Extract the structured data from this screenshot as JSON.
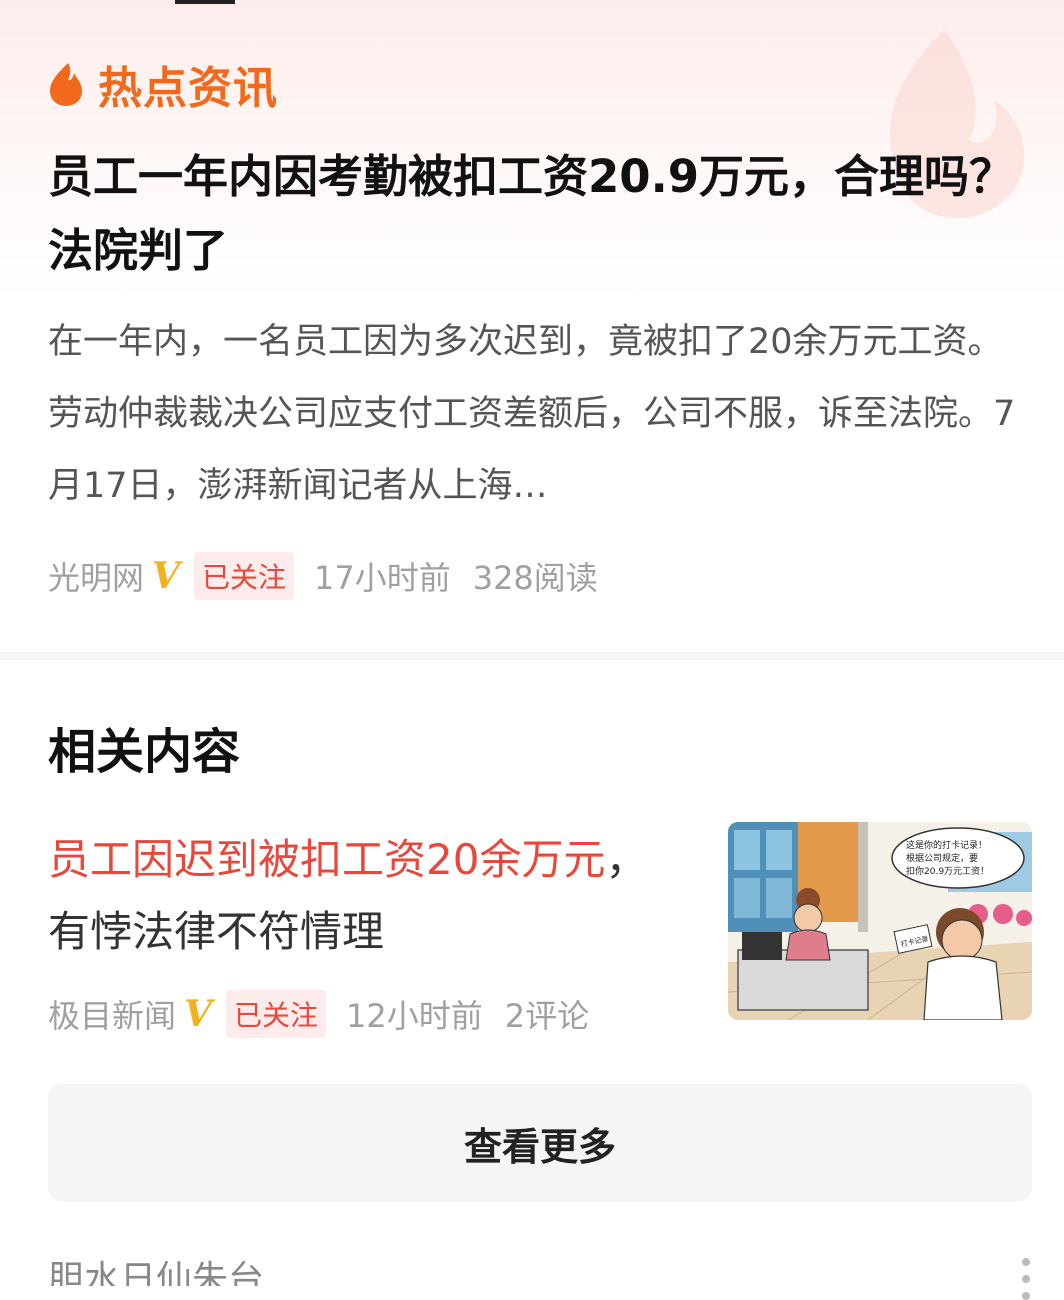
{
  "hot_section": {
    "label": "热点资讯",
    "headline": "员工一年内因考勤被扣工资20.9万元，合理吗？法院判了",
    "summary": "在一年内，一名员工因为多次迟到，竟被扣了20余万元工资。劳动仲裁裁决公司应支付工资差额后，公司不服，诉至法院。7月17日，澎湃新闻记者从上海…",
    "source": "光明网",
    "verified_mark": "V",
    "follow_status": "已关注",
    "time": "17小时前",
    "stat": "328阅读"
  },
  "related": {
    "section_title": "相关内容",
    "item": {
      "title_highlight": "员工因迟到被扣工资20余万元",
      "title_rest": "，有悖法律不符情理",
      "source": "极目新闻",
      "verified_mark": "V",
      "follow_status": "已关注",
      "time": "12小时前",
      "stat": "2评论",
      "thumbnail": {
        "bubble_text_1": "这是你的打卡记录！",
        "bubble_text_2": "根据公司规定，要",
        "bubble_text_3": "扣你20.9万元工资！",
        "card_text": "打卡记录"
      }
    },
    "more_button": "查看更多"
  },
  "next_section": {
    "title_partial": "胆水日仙朱台"
  },
  "colors": {
    "accent_orange": "#f2691c",
    "highlight_red": "#e8473b",
    "verified_gold": "#f2b21b"
  }
}
